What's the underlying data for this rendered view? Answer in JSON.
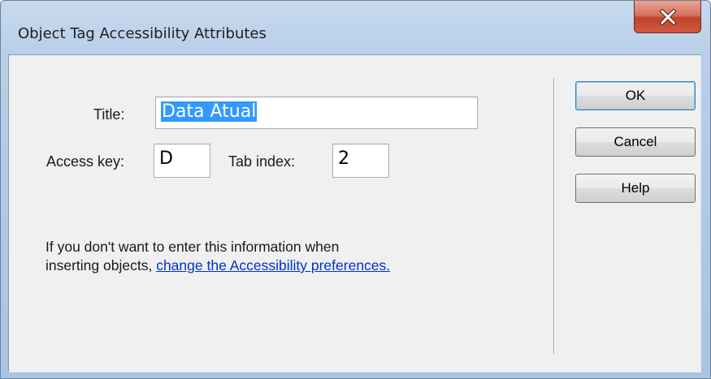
{
  "window": {
    "title": "Object Tag Accessibility Attributes",
    "close_icon": "close-x-icon"
  },
  "form": {
    "title_label": "Title:",
    "title_value": "Data Atual",
    "access_key_label": "Access key:",
    "access_key_value": "D",
    "tab_index_label": "Tab index:",
    "tab_index_value": "2"
  },
  "buttons": {
    "ok": "OK",
    "cancel": "Cancel",
    "help": "Help"
  },
  "info": {
    "line1": "If you don't want to enter this information when",
    "line2_prefix": "inserting objects,",
    "link_text": "change the Accessibility preferences."
  },
  "colors": {
    "selection": "#3399ff",
    "link": "#0033cc",
    "close_button": "#c7452f"
  }
}
